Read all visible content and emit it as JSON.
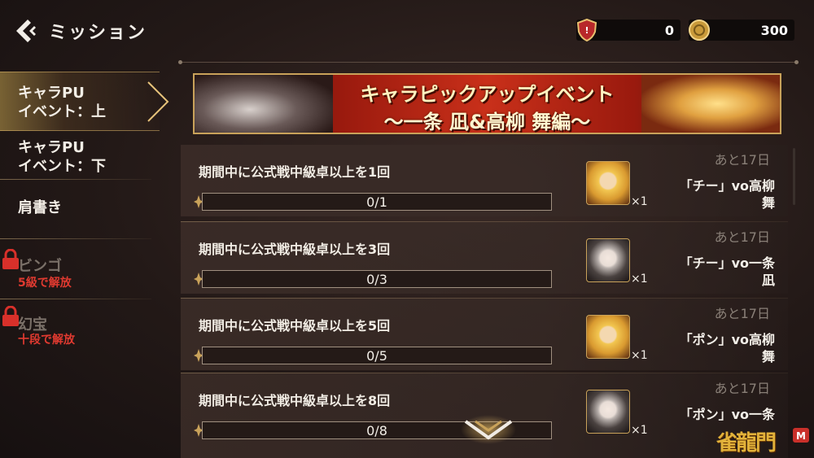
{
  "header": {
    "title": "ミッション",
    "currency_a_value": "0",
    "currency_b_value": "300"
  },
  "sidebar": {
    "items": [
      {
        "label_line1": "キャラPU",
        "label_line2": "イベント：上"
      },
      {
        "label_line1": "キャラPU",
        "label_line2": "イベント：下"
      },
      {
        "label_line1": "肩書き"
      },
      {
        "label_line1": "ビンゴ",
        "unlock": "5級で解放"
      },
      {
        "label_line1": "幻宝",
        "unlock": "十段で解放"
      }
    ]
  },
  "banner": {
    "title": "キャラピックアップイベント",
    "subtitle": "〜一条 凪&高柳 舞編〜"
  },
  "missions": [
    {
      "title": "期間中に公式戦中級卓以上を1回",
      "progress": "0/1",
      "progress_fraction": 0,
      "days": "あと17日",
      "reward_line1": "「チー」vo高柳",
      "reward_line2": "舞",
      "count": "×1"
    },
    {
      "title": "期間中に公式戦中級卓以上を3回",
      "progress": "0/3",
      "progress_fraction": 0,
      "days": "あと17日",
      "reward_line1": "「チー」vo一条",
      "reward_line2": "凪",
      "count": "×1"
    },
    {
      "title": "期間中に公式戦中級卓以上を5回",
      "progress": "0/5",
      "progress_fraction": 0,
      "days": "あと17日",
      "reward_line1": "「ポン」vo高柳",
      "reward_line2": "舞",
      "count": "×1"
    },
    {
      "title": "期間中に公式戦中級卓以上を8回",
      "progress": "0/8",
      "progress_fraction": 0,
      "days": "あと17日",
      "reward_line1": "「ポン」vo一条",
      "reward_line2": "",
      "count": "×1"
    }
  ],
  "logo": {
    "text": "雀龍門",
    "badge": "M"
  },
  "colors": {
    "accent_gold": "#c9a25a",
    "lock_red": "#e03a30"
  }
}
